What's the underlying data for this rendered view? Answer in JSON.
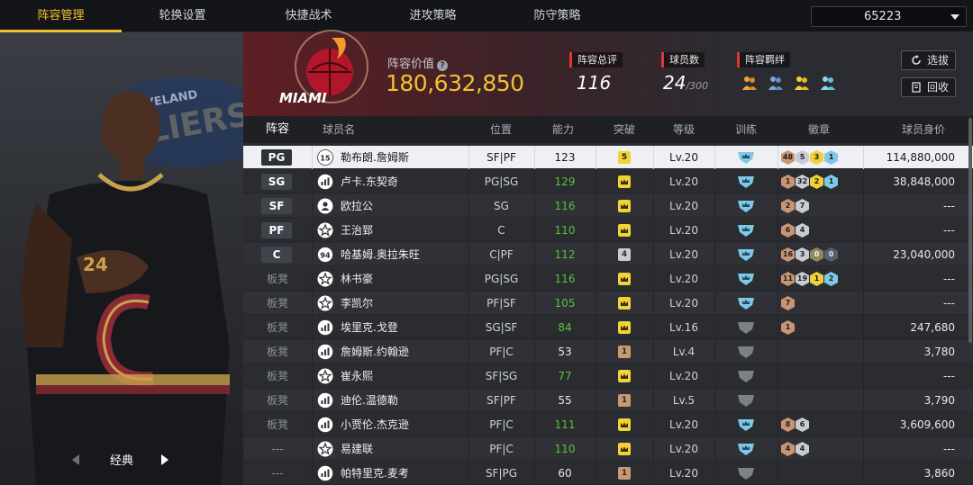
{
  "nav": {
    "tabs": [
      "阵容管理",
      "轮换设置",
      "快捷战术",
      "进攻策略",
      "防守策略"
    ],
    "active_index": 0,
    "selector_value": "65223"
  },
  "left": {
    "style_label": "经典",
    "banner_text": "CLEVELAND CAVALIERS"
  },
  "header": {
    "team_logo_text": "MIAMI",
    "value_label": "阵容价值",
    "value": "180,632,850",
    "rating_label": "阵容总评",
    "rating": "116",
    "players_label": "球员数",
    "players": "24",
    "players_max": "/300",
    "bond_label": "阵容羁绊",
    "bond_icons": [
      "bond-icon-orange",
      "bond-icon-blue",
      "bond-icon-yellow",
      "bond-icon-cyan"
    ],
    "select_button": "选拔",
    "recycle_button": "回收"
  },
  "columns": [
    "阵容",
    "球员名",
    "位置",
    "能力",
    "突破",
    "等级",
    "训练",
    "徽章",
    "球员身价"
  ],
  "rows": [
    {
      "slot": "PG",
      "slot_type": "starter",
      "icon": "15",
      "name": "勒布朗.詹姆斯",
      "pos": "SF|PF",
      "ability": "123",
      "ability_color": "white",
      "breakthrough": "5",
      "bt_type": "yellow",
      "level": "Lv.20",
      "training": "blue",
      "badges": [
        [
          "48",
          "bronze"
        ],
        [
          "5",
          "silver"
        ],
        [
          "3",
          "gold"
        ],
        [
          "1",
          "blue"
        ]
      ],
      "price": "114,880,000",
      "selected": true
    },
    {
      "slot": "SG",
      "slot_type": "starter",
      "icon": "bars",
      "name": "卢卡.东契奇",
      "pos": "PG|SG",
      "ability": "129",
      "ability_color": "green",
      "breakthrough": "crown",
      "bt_type": "yellow",
      "level": "Lv.20",
      "training": "blue",
      "badges": [
        [
          "1",
          "bronze"
        ],
        [
          "32",
          "silver"
        ],
        [
          "2",
          "gold"
        ],
        [
          "1",
          "blue"
        ]
      ],
      "price": "38,848,000"
    },
    {
      "slot": "SF",
      "slot_type": "starter",
      "icon": "person",
      "name": "欧拉公",
      "pos": "SG",
      "ability": "116",
      "ability_color": "green",
      "breakthrough": "crown",
      "bt_type": "yellow",
      "level": "Lv.20",
      "training": "blue",
      "badges": [
        [
          "2",
          "bronze"
        ],
        [
          "7",
          "silver"
        ]
      ],
      "price": "---"
    },
    {
      "slot": "PF",
      "slot_type": "starter",
      "icon": "star",
      "name": "王治郅",
      "pos": "C",
      "ability": "110",
      "ability_color": "green",
      "breakthrough": "crown",
      "bt_type": "yellow",
      "level": "Lv.20",
      "training": "blue",
      "badges": [
        [
          "6",
          "bronze"
        ],
        [
          "4",
          "silver"
        ]
      ],
      "price": "---"
    },
    {
      "slot": "C",
      "slot_type": "starter",
      "icon": "94",
      "name": "哈基姆.奥拉朱旺",
      "pos": "C|PF",
      "ability": "112",
      "ability_color": "green",
      "breakthrough": "4",
      "bt_type": "gray",
      "level": "Lv.20",
      "training": "blue",
      "badges": [
        [
          "16",
          "bronze"
        ],
        [
          "3",
          "silver"
        ],
        [
          "0",
          "olive"
        ],
        [
          "0",
          "dark"
        ]
      ],
      "price": "23,040,000"
    },
    {
      "slot": "板凳",
      "slot_type": "bench",
      "icon": "star",
      "name": "林书豪",
      "pos": "PG|SG",
      "ability": "116",
      "ability_color": "green",
      "breakthrough": "crown",
      "bt_type": "yellow",
      "level": "Lv.20",
      "training": "blue",
      "badges": [
        [
          "11",
          "bronze"
        ],
        [
          "19",
          "silver"
        ],
        [
          "1",
          "gold"
        ],
        [
          "2",
          "blue"
        ]
      ],
      "price": "---"
    },
    {
      "slot": "板凳",
      "slot_type": "bench",
      "icon": "star",
      "name": "李凯尔",
      "pos": "PF|SF",
      "ability": "105",
      "ability_color": "green",
      "breakthrough": "crown",
      "bt_type": "yellow",
      "level": "Lv.20",
      "training": "blue",
      "badges": [
        [
          "7",
          "bronze"
        ]
      ],
      "price": "---"
    },
    {
      "slot": "板凳",
      "slot_type": "bench",
      "icon": "bars",
      "name": "埃里克.戈登",
      "pos": "SG|SF",
      "ability": "84",
      "ability_color": "green",
      "breakthrough": "crown",
      "bt_type": "yellow",
      "level": "Lv.16",
      "training": "gray",
      "badges": [
        [
          "1",
          "bronze"
        ]
      ],
      "price": "247,680"
    },
    {
      "slot": "板凳",
      "slot_type": "bench",
      "icon": "bars",
      "name": "詹姆斯.约翰逊",
      "pos": "PF|C",
      "ability": "53",
      "ability_color": "white",
      "breakthrough": "1",
      "bt_type": "brown",
      "level": "Lv.4",
      "training": "gray",
      "badges": [],
      "price": "3,780"
    },
    {
      "slot": "板凳",
      "slot_type": "bench",
      "icon": "star",
      "name": "崔永熙",
      "pos": "SF|SG",
      "ability": "77",
      "ability_color": "green",
      "breakthrough": "crown",
      "bt_type": "yellow",
      "level": "Lv.20",
      "training": "gray",
      "badges": [],
      "price": "---"
    },
    {
      "slot": "板凳",
      "slot_type": "bench",
      "icon": "bars",
      "name": "迪伦.温德勒",
      "pos": "SF|PF",
      "ability": "55",
      "ability_color": "white",
      "breakthrough": "1",
      "bt_type": "brown",
      "level": "Lv.5",
      "training": "gray",
      "badges": [],
      "price": "3,790"
    },
    {
      "slot": "板凳",
      "slot_type": "bench",
      "icon": "bars",
      "name": "小贾伦.杰克逊",
      "pos": "PF|C",
      "ability": "111",
      "ability_color": "green",
      "breakthrough": "crown",
      "bt_type": "yellow",
      "level": "Lv.20",
      "training": "blue",
      "badges": [
        [
          "8",
          "bronze"
        ],
        [
          "6",
          "silver"
        ]
      ],
      "price": "3,609,600"
    },
    {
      "slot": "---",
      "slot_type": "none",
      "icon": "star",
      "name": "易建联",
      "pos": "PF|C",
      "ability": "110",
      "ability_color": "green",
      "breakthrough": "crown",
      "bt_type": "yellow",
      "level": "Lv.20",
      "training": "blue",
      "badges": [
        [
          "4",
          "bronze"
        ],
        [
          "4",
          "silver"
        ]
      ],
      "price": "---"
    },
    {
      "slot": "---",
      "slot_type": "none",
      "icon": "bars",
      "name": "帕特里克.麦考",
      "pos": "SF|PG",
      "ability": "60",
      "ability_color": "white",
      "breakthrough": "1",
      "bt_type": "brown",
      "level": "Lv.20",
      "training": "gray",
      "badges": [],
      "price": "3,860"
    }
  ],
  "colors": {
    "accent": "#f2c230",
    "green": "#58c23a",
    "red": "#e0353a"
  }
}
